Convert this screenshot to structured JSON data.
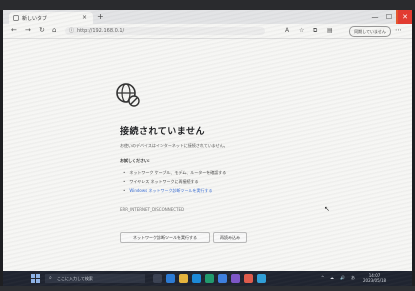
{
  "browser": {
    "tab_title": "新しいタブ",
    "close_tab_glyph": "×",
    "new_tab_glyph": "+",
    "url": "http://192.168.0.1/",
    "profile_label": "同期していません",
    "window_controls": {
      "minimize": "—",
      "maximize": "☐",
      "close": "✕"
    }
  },
  "error_page": {
    "icon": "globe-no-connection-icon",
    "title": "接続されていません",
    "description": "お使いのデバイスはインターネットに接続されていません。",
    "try_heading": "お試しください:",
    "suggestions": [
      "ネットワーク ケーブル、モデム、ルーターを確認する",
      "ワイヤレス ネットワークに再接続する",
      "Windows ネットワーク診断ツールを実行する"
    ],
    "error_code": "ERR_INTERNET_DISCONNECTED",
    "buttons": [
      "ネットワーク診断ツールを実行する",
      "再読み込み"
    ]
  },
  "taskbar": {
    "search_placeholder": "ここに入力して検索",
    "tray_items": [
      "^",
      "☁",
      "🔊",
      "あ"
    ],
    "clock_time": "14:07",
    "clock_date": "2023/05/18"
  },
  "colors": {
    "close_highlight": "#e43a2f",
    "taskbar": "#1f2430",
    "link": "#3b6fd6"
  }
}
